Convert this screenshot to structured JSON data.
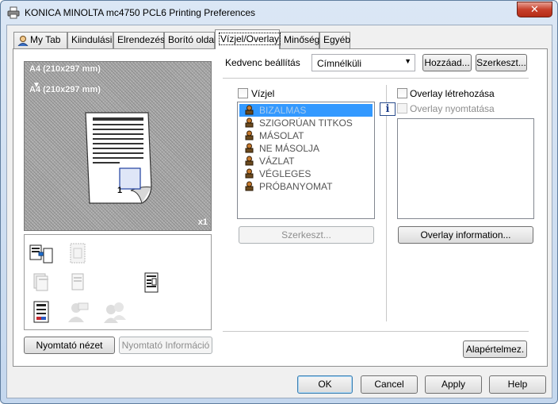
{
  "window": {
    "title": "KONICA MINOLTA mc4750 PCL6 Printing Preferences",
    "close_label": "✕"
  },
  "tabs": [
    {
      "label": "My Tab"
    },
    {
      "label": "Kiindulási"
    },
    {
      "label": "Elrendezés"
    },
    {
      "label": "Borító oldal"
    },
    {
      "label": "Vízjel/Overlay"
    },
    {
      "label": "Minőség"
    },
    {
      "label": "Egyéb"
    }
  ],
  "preview": {
    "paper_line1": "A4 (210x297 mm)",
    "paper_line2": "A4 (210x297 mm)",
    "copies": "x1",
    "page_number": "1"
  },
  "left_buttons": {
    "printer_view": "Nyomtató nézet",
    "printer_info": "Nyomtató Információ"
  },
  "favorites": {
    "label": "Kedvenc beállítás",
    "value": "Címnélküli",
    "add_label": "Hozzáad...",
    "edit_label": "Szerkeszt..."
  },
  "watermark": {
    "checkbox_label": "Vízjel",
    "items": [
      "BIZALMAS",
      "SZIGORÚAN TITKOS",
      "MÁSOLAT",
      "NE MÁSOLJA",
      "VÁZLAT",
      "VÉGLEGES",
      "PRÓBANYOMAT"
    ],
    "selected_index": 0,
    "edit_label": "Szerkeszt..."
  },
  "overlay": {
    "create_label": "Overlay létrehozása",
    "print_label": "Overlay nyomtatása",
    "info_button": "Overlay information...",
    "info_icon": "i"
  },
  "defaults_label": "Alapértelmez.",
  "footer": {
    "ok": "OK",
    "cancel": "Cancel",
    "apply": "Apply",
    "help": "Help"
  }
}
